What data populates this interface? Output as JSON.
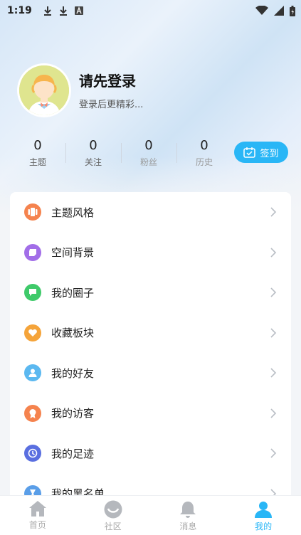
{
  "status_bar": {
    "time": "1:19",
    "icons": [
      "download-icon",
      "download-icon",
      "a-icon"
    ],
    "right_icons": [
      "wifi-icon",
      "signal-icon",
      "battery-icon"
    ]
  },
  "profile": {
    "username": "请先登录",
    "subtitle": "登录后更精彩..."
  },
  "stats": [
    {
      "value": "0",
      "label": "主题"
    },
    {
      "value": "0",
      "label": "关注"
    },
    {
      "value": "0",
      "label": "粉丝"
    },
    {
      "value": "0",
      "label": "历史"
    }
  ],
  "checkin": {
    "label": "签到"
  },
  "menu": [
    {
      "label": "主题风格",
      "icon": "theme-icon",
      "color": "#f5834e"
    },
    {
      "label": "空间背景",
      "icon": "background-icon",
      "color": "#a26ee8"
    },
    {
      "label": "我的圈子",
      "icon": "chat-icon",
      "color": "#3fca6a"
    },
    {
      "label": "收藏板块",
      "icon": "heart-icon",
      "color": "#f5a43a"
    },
    {
      "label": "我的好友",
      "icon": "user-icon",
      "color": "#5bb8f0"
    },
    {
      "label": "我的访客",
      "icon": "badge-icon",
      "color": "#f5834e"
    },
    {
      "label": "我的足迹",
      "icon": "clock-icon",
      "color": "#5a6fe0"
    },
    {
      "label": "我的黑名单",
      "icon": "blacklist-icon",
      "color": "#5a9ee8"
    }
  ],
  "nav": [
    {
      "label": "首页",
      "icon": "home-icon"
    },
    {
      "label": "社区",
      "icon": "community-icon"
    },
    {
      "label": "消息",
      "icon": "bell-icon"
    },
    {
      "label": "我的",
      "icon": "profile-icon"
    }
  ],
  "colors": {
    "accent": "#29b6f6",
    "inactive": "#aaaaaa"
  }
}
